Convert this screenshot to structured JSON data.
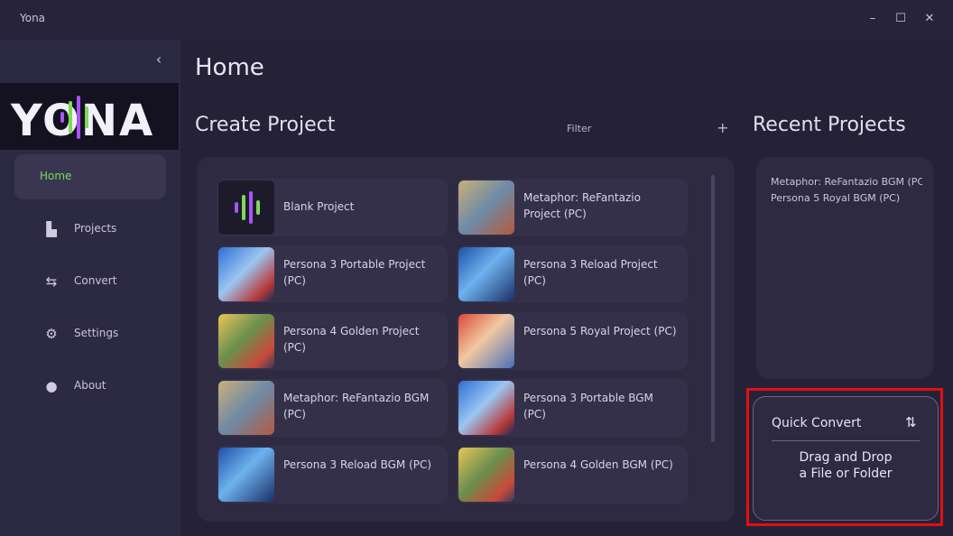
{
  "window": {
    "title": "Yona",
    "controls": {
      "minimize": "–",
      "maximize": "☐",
      "close": "✕"
    }
  },
  "sidebar": {
    "collapse_icon": "chevron-left-icon",
    "logo_text": "YONA",
    "items": [
      {
        "label": "Home",
        "icon": "home",
        "active": true
      },
      {
        "label": "Projects",
        "icon": "projects-icon"
      },
      {
        "label": "Convert",
        "icon": "convert-icon"
      },
      {
        "label": "Settings",
        "icon": "gear-icon"
      },
      {
        "label": "About",
        "icon": "info-icon"
      }
    ]
  },
  "main": {
    "title": "Home",
    "create_project": {
      "title": "Create Project",
      "filter_label": "Filter",
      "add_label": "+",
      "cards": [
        {
          "label": "Blank Project",
          "thumb": "blank"
        },
        {
          "label": "Metaphor: ReFantazio Project (PC)",
          "thumb": "metaphor"
        },
        {
          "label": "Persona 3 Portable Project (PC)",
          "thumb": "p3p"
        },
        {
          "label": "Persona 3 Reload Project (PC)",
          "thumb": "p3r"
        },
        {
          "label": "Persona 4 Golden Project (PC)",
          "thumb": "p4g"
        },
        {
          "label": "Persona 5 Royal Project (PC)",
          "thumb": "p5r"
        },
        {
          "label": "Metaphor: ReFantazio BGM (PC)",
          "thumb": "metaphor"
        },
        {
          "label": "Persona 3 Portable BGM (PC)",
          "thumb": "p3p"
        },
        {
          "label": "Persona 3 Reload BGM (PC)",
          "thumb": "p3r"
        },
        {
          "label": "Persona 4 Golden BGM (PC)",
          "thumb": "p4g"
        }
      ]
    },
    "recent_projects": {
      "title": "Recent Projects",
      "items": [
        "Metaphor: ReFantazio BGM (PC)",
        "Persona 5 Royal BGM (PC)"
      ]
    },
    "quick_convert": {
      "title": "Quick Convert",
      "icon": "swap-arrows-icon",
      "drop_line1": "Drag and Drop",
      "drop_line2": "a File or Folder"
    }
  },
  "colors": {
    "accent_green": "#7ed957",
    "accent_purple": "#a855f7",
    "highlight_red": "#e01010"
  }
}
